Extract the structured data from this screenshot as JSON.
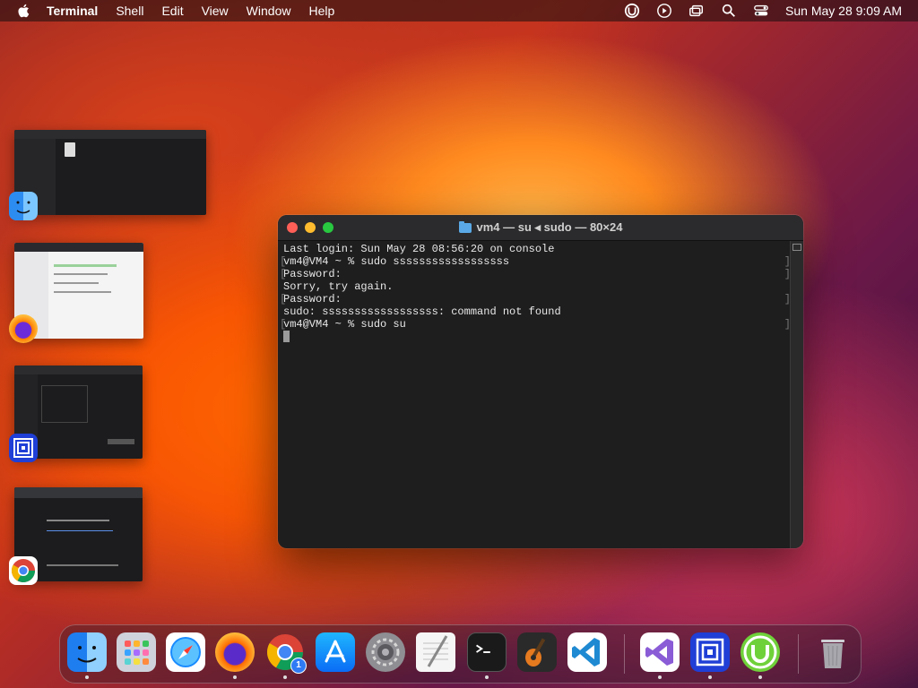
{
  "menubar": {
    "app": "Terminal",
    "items": [
      "Shell",
      "Edit",
      "View",
      "Window",
      "Help"
    ],
    "clock": "Sun May 28  9:09 AM"
  },
  "terminal": {
    "title": "vm4 — su ◂ sudo — 80×24",
    "lines": [
      "Last login: Sun May 28 08:56:20 on console",
      "vm4@VM4 ~ % sudo ssssssssssssssssss",
      "Password:",
      "Sorry, try again.",
      "Password:",
      "sudo: ssssssssssssssssss: command not found",
      "vm4@VM4 ~ % sudo su"
    ]
  },
  "stage": [
    {
      "app": "finder-icon"
    },
    {
      "app": "firefox-icon"
    },
    {
      "app": "utm-icon"
    },
    {
      "app": "chrome-icon"
    }
  ],
  "dock": {
    "chrome_badge": "1",
    "apps": [
      "finder",
      "launchpad",
      "safari",
      "firefox",
      "chrome",
      "app-store",
      "system-settings",
      "textedit",
      "terminal",
      "garageband",
      "vscode",
      "visual-studio",
      "utm",
      "utorrent",
      "trash"
    ]
  }
}
